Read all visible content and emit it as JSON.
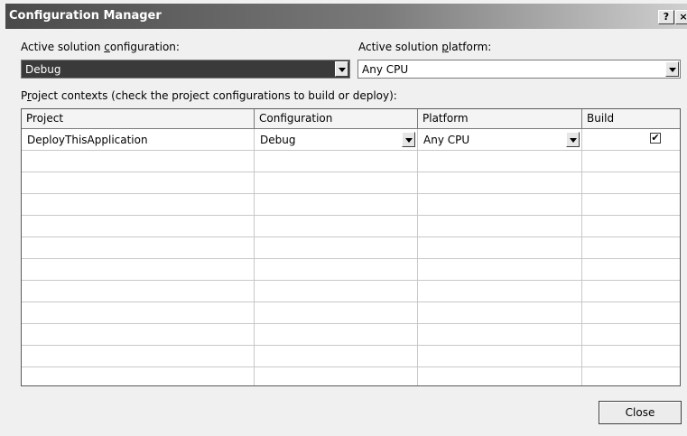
{
  "window": {
    "title": "Configuration Manager",
    "help_glyph": "?",
    "close_glyph": "×"
  },
  "config": {
    "label_pre": "Active solution ",
    "label_acc": "c",
    "label_post": "onfiguration:",
    "value": "Debug"
  },
  "platform": {
    "label_pre": "Active solution ",
    "label_acc": "p",
    "label_post": "latform:",
    "value": "Any CPU"
  },
  "contexts": {
    "label_pre": "P",
    "label_acc": "r",
    "label_post": "oject contexts (check the project configurations to build or deploy):"
  },
  "table": {
    "headers": [
      "Project",
      "Configuration",
      "Platform",
      "Build"
    ],
    "rows": [
      {
        "project": "DeployThisApplication",
        "configuration": "Debug",
        "platform": "Any CPU",
        "build": true
      }
    ]
  },
  "buttons": {
    "close": "Close"
  }
}
